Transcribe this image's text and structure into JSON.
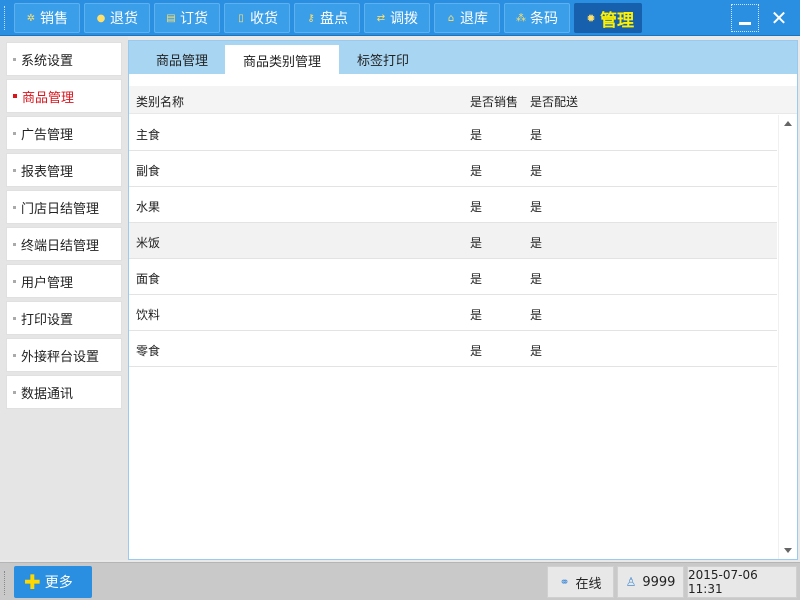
{
  "toolbar": {
    "items": [
      {
        "label": "销售",
        "icon": "gear-small-icon"
      },
      {
        "label": "退货",
        "icon": "circle-icon"
      },
      {
        "label": "订货",
        "icon": "receipt-icon"
      },
      {
        "label": "收货",
        "icon": "document-icon"
      },
      {
        "label": "盘点",
        "icon": "key-icon"
      },
      {
        "label": "调拨",
        "icon": "swap-arrows-icon"
      },
      {
        "label": "退库",
        "icon": "warehouse-icon"
      },
      {
        "label": "条码",
        "icon": "barcode-icon"
      },
      {
        "label": "管理",
        "icon": "gear-icon",
        "active": true
      }
    ]
  },
  "sidebar": {
    "items": [
      {
        "label": "系统设置"
      },
      {
        "label": "商品管理",
        "active": true
      },
      {
        "label": "广告管理"
      },
      {
        "label": "报表管理"
      },
      {
        "label": "门店日结管理"
      },
      {
        "label": "终端日结管理"
      },
      {
        "label": "用户管理"
      },
      {
        "label": "打印设置"
      },
      {
        "label": "外接秤台设置"
      },
      {
        "label": "数据通讯"
      }
    ]
  },
  "tabs": [
    {
      "label": "商品管理"
    },
    {
      "label": "商品类别管理",
      "active": true
    },
    {
      "label": "标签打印"
    }
  ],
  "table": {
    "columns": [
      "类别名称",
      "是否销售",
      "是否配送"
    ],
    "rows": [
      [
        "主食",
        "是",
        "是"
      ],
      [
        "副食",
        "是",
        "是"
      ],
      [
        "水果",
        "是",
        "是"
      ],
      [
        "米饭",
        "是",
        "是"
      ],
      [
        "面食",
        "是",
        "是"
      ],
      [
        "饮料",
        "是",
        "是"
      ],
      [
        "零食",
        "是",
        "是"
      ]
    ]
  },
  "bottom": {
    "more_label": "更多",
    "status_online": "在线",
    "user_id": "9999",
    "datetime": "2015-07-06 11:31"
  },
  "colors": {
    "toolbar_bg": "#2a8fe0",
    "active_tab_bg": "#1660ad",
    "active_text_yellow": "#fff200",
    "sidebar_active_red": "#d9161e",
    "tab_strip_bg": "#a8d6f2"
  }
}
